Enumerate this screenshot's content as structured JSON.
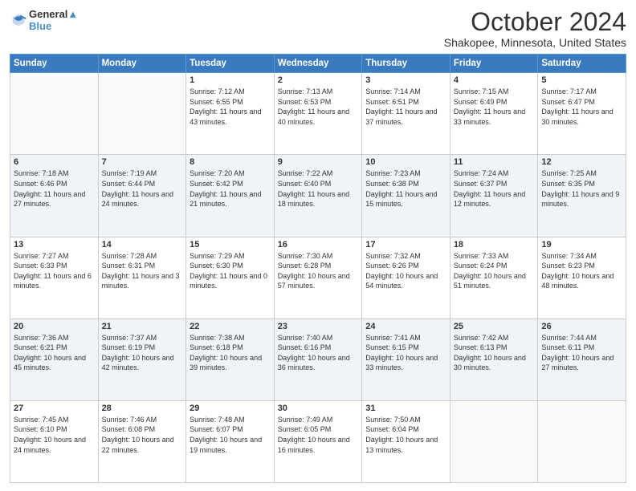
{
  "header": {
    "logo_line1": "General",
    "logo_line2": "Blue",
    "title": "October 2024",
    "subtitle": "Shakopee, Minnesota, United States"
  },
  "days_of_week": [
    "Sunday",
    "Monday",
    "Tuesday",
    "Wednesday",
    "Thursday",
    "Friday",
    "Saturday"
  ],
  "weeks": [
    [
      {
        "day": "",
        "sunrise": "",
        "sunset": "",
        "daylight": ""
      },
      {
        "day": "",
        "sunrise": "",
        "sunset": "",
        "daylight": ""
      },
      {
        "day": "1",
        "sunrise": "Sunrise: 7:12 AM",
        "sunset": "Sunset: 6:55 PM",
        "daylight": "Daylight: 11 hours and 43 minutes."
      },
      {
        "day": "2",
        "sunrise": "Sunrise: 7:13 AM",
        "sunset": "Sunset: 6:53 PM",
        "daylight": "Daylight: 11 hours and 40 minutes."
      },
      {
        "day": "3",
        "sunrise": "Sunrise: 7:14 AM",
        "sunset": "Sunset: 6:51 PM",
        "daylight": "Daylight: 11 hours and 37 minutes."
      },
      {
        "day": "4",
        "sunrise": "Sunrise: 7:15 AM",
        "sunset": "Sunset: 6:49 PM",
        "daylight": "Daylight: 11 hours and 33 minutes."
      },
      {
        "day": "5",
        "sunrise": "Sunrise: 7:17 AM",
        "sunset": "Sunset: 6:47 PM",
        "daylight": "Daylight: 11 hours and 30 minutes."
      }
    ],
    [
      {
        "day": "6",
        "sunrise": "Sunrise: 7:18 AM",
        "sunset": "Sunset: 6:46 PM",
        "daylight": "Daylight: 11 hours and 27 minutes."
      },
      {
        "day": "7",
        "sunrise": "Sunrise: 7:19 AM",
        "sunset": "Sunset: 6:44 PM",
        "daylight": "Daylight: 11 hours and 24 minutes."
      },
      {
        "day": "8",
        "sunrise": "Sunrise: 7:20 AM",
        "sunset": "Sunset: 6:42 PM",
        "daylight": "Daylight: 11 hours and 21 minutes."
      },
      {
        "day": "9",
        "sunrise": "Sunrise: 7:22 AM",
        "sunset": "Sunset: 6:40 PM",
        "daylight": "Daylight: 11 hours and 18 minutes."
      },
      {
        "day": "10",
        "sunrise": "Sunrise: 7:23 AM",
        "sunset": "Sunset: 6:38 PM",
        "daylight": "Daylight: 11 hours and 15 minutes."
      },
      {
        "day": "11",
        "sunrise": "Sunrise: 7:24 AM",
        "sunset": "Sunset: 6:37 PM",
        "daylight": "Daylight: 11 hours and 12 minutes."
      },
      {
        "day": "12",
        "sunrise": "Sunrise: 7:25 AM",
        "sunset": "Sunset: 6:35 PM",
        "daylight": "Daylight: 11 hours and 9 minutes."
      }
    ],
    [
      {
        "day": "13",
        "sunrise": "Sunrise: 7:27 AM",
        "sunset": "Sunset: 6:33 PM",
        "daylight": "Daylight: 11 hours and 6 minutes."
      },
      {
        "day": "14",
        "sunrise": "Sunrise: 7:28 AM",
        "sunset": "Sunset: 6:31 PM",
        "daylight": "Daylight: 11 hours and 3 minutes."
      },
      {
        "day": "15",
        "sunrise": "Sunrise: 7:29 AM",
        "sunset": "Sunset: 6:30 PM",
        "daylight": "Daylight: 11 hours and 0 minutes."
      },
      {
        "day": "16",
        "sunrise": "Sunrise: 7:30 AM",
        "sunset": "Sunset: 6:28 PM",
        "daylight": "Daylight: 10 hours and 57 minutes."
      },
      {
        "day": "17",
        "sunrise": "Sunrise: 7:32 AM",
        "sunset": "Sunset: 6:26 PM",
        "daylight": "Daylight: 10 hours and 54 minutes."
      },
      {
        "day": "18",
        "sunrise": "Sunrise: 7:33 AM",
        "sunset": "Sunset: 6:24 PM",
        "daylight": "Daylight: 10 hours and 51 minutes."
      },
      {
        "day": "19",
        "sunrise": "Sunrise: 7:34 AM",
        "sunset": "Sunset: 6:23 PM",
        "daylight": "Daylight: 10 hours and 48 minutes."
      }
    ],
    [
      {
        "day": "20",
        "sunrise": "Sunrise: 7:36 AM",
        "sunset": "Sunset: 6:21 PM",
        "daylight": "Daylight: 10 hours and 45 minutes."
      },
      {
        "day": "21",
        "sunrise": "Sunrise: 7:37 AM",
        "sunset": "Sunset: 6:19 PM",
        "daylight": "Daylight: 10 hours and 42 minutes."
      },
      {
        "day": "22",
        "sunrise": "Sunrise: 7:38 AM",
        "sunset": "Sunset: 6:18 PM",
        "daylight": "Daylight: 10 hours and 39 minutes."
      },
      {
        "day": "23",
        "sunrise": "Sunrise: 7:40 AM",
        "sunset": "Sunset: 6:16 PM",
        "daylight": "Daylight: 10 hours and 36 minutes."
      },
      {
        "day": "24",
        "sunrise": "Sunrise: 7:41 AM",
        "sunset": "Sunset: 6:15 PM",
        "daylight": "Daylight: 10 hours and 33 minutes."
      },
      {
        "day": "25",
        "sunrise": "Sunrise: 7:42 AM",
        "sunset": "Sunset: 6:13 PM",
        "daylight": "Daylight: 10 hours and 30 minutes."
      },
      {
        "day": "26",
        "sunrise": "Sunrise: 7:44 AM",
        "sunset": "Sunset: 6:11 PM",
        "daylight": "Daylight: 10 hours and 27 minutes."
      }
    ],
    [
      {
        "day": "27",
        "sunrise": "Sunrise: 7:45 AM",
        "sunset": "Sunset: 6:10 PM",
        "daylight": "Daylight: 10 hours and 24 minutes."
      },
      {
        "day": "28",
        "sunrise": "Sunrise: 7:46 AM",
        "sunset": "Sunset: 6:08 PM",
        "daylight": "Daylight: 10 hours and 22 minutes."
      },
      {
        "day": "29",
        "sunrise": "Sunrise: 7:48 AM",
        "sunset": "Sunset: 6:07 PM",
        "daylight": "Daylight: 10 hours and 19 minutes."
      },
      {
        "day": "30",
        "sunrise": "Sunrise: 7:49 AM",
        "sunset": "Sunset: 6:05 PM",
        "daylight": "Daylight: 10 hours and 16 minutes."
      },
      {
        "day": "31",
        "sunrise": "Sunrise: 7:50 AM",
        "sunset": "Sunset: 6:04 PM",
        "daylight": "Daylight: 10 hours and 13 minutes."
      },
      {
        "day": "",
        "sunrise": "",
        "sunset": "",
        "daylight": ""
      },
      {
        "day": "",
        "sunrise": "",
        "sunset": "",
        "daylight": ""
      }
    ]
  ]
}
